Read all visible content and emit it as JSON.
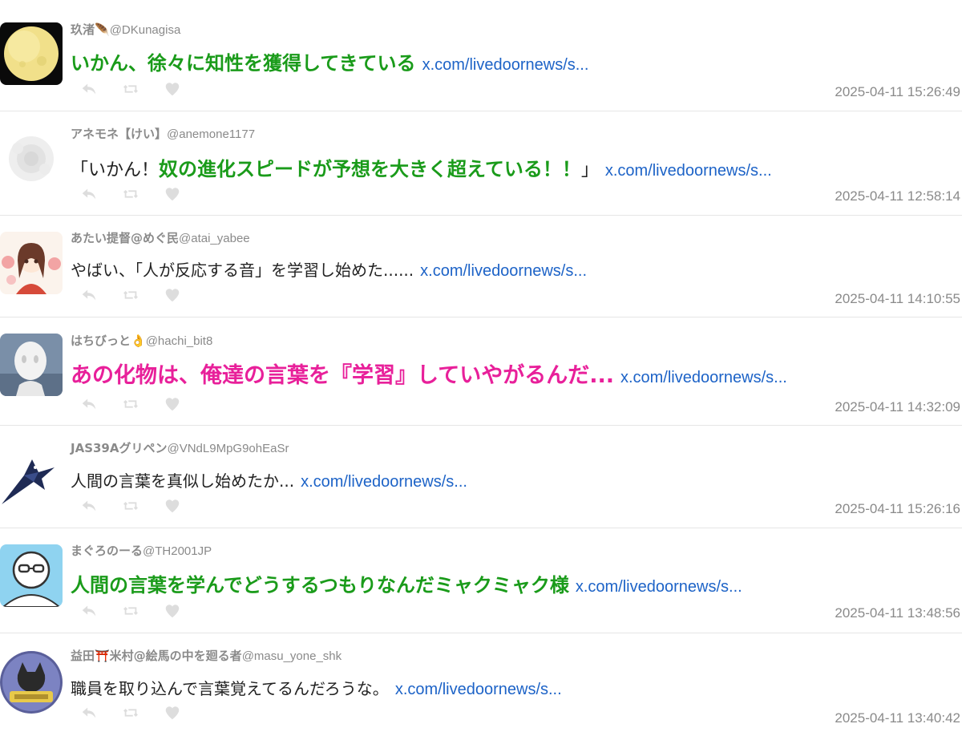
{
  "tweets": [
    {
      "username": "玖渚🪶",
      "handle": "@DKunagisa",
      "prefix": "",
      "highlight": "いかん、徐々に知性を獲得してきている",
      "suffix": "",
      "style": "green",
      "link": "x.com/livedoornews/s...",
      "timestamp": "2025-04-11 15:26:49",
      "avatar": "moon-avatar"
    },
    {
      "username": "アネモネ【けい】",
      "handle": "@anemone1177",
      "prefix": "「いかん！",
      "highlight": "奴の進化スピードが予想を大きく超えている！！",
      "suffix": "」",
      "style": "mixed",
      "link": "x.com/livedoornews/s...",
      "timestamp": "2025-04-11 12:58:14",
      "avatar": "faded-flower-avatar"
    },
    {
      "username": "あたい提督@めぐ民",
      "handle": "@atai_yabee",
      "prefix": "",
      "highlight": "やばい、「人が反応する音」を学習し始めた......",
      "suffix": "",
      "style": "normal",
      "link": "x.com/livedoornews/s...",
      "timestamp": "2025-04-11 14:10:55",
      "avatar": "anime-girl-avatar"
    },
    {
      "username": "はちびっと👌",
      "handle": "@hachi_bit8",
      "prefix": "",
      "highlight": "あの化物は、俺達の言葉を『学習』していやがるんだ...",
      "suffix": "",
      "style": "pink",
      "link": "x.com/livedoornews/s...",
      "timestamp": "2025-04-11 14:32:09",
      "avatar": "white-robot-avatar"
    },
    {
      "username": "JAS39Aグリペン",
      "handle": "@VNdL9MpG9ohEaSr",
      "prefix": "",
      "highlight": "人間の言葉を真似し始めたか...",
      "suffix": "",
      "style": "normal",
      "link": "x.com/livedoornews/s...",
      "timestamp": "2025-04-11 15:26:16",
      "avatar": "jet-avatar"
    },
    {
      "username": "まぐろのーる",
      "handle": "@TH2001JP",
      "prefix": "",
      "highlight": "人間の言葉を学んでどうするつもりなんだミャクミャク様",
      "suffix": "",
      "style": "green",
      "link": "x.com/livedoornews/s...",
      "timestamp": "2025-04-11 13:48:56",
      "avatar": "glasses-face-avatar"
    },
    {
      "username": "益田⛩️米村@絵馬の中を廻る者",
      "handle": "@masu_yone_shk",
      "prefix": "",
      "highlight": "職員を取り込んで言葉覚えてるんだろうな。",
      "suffix": "",
      "style": "normal",
      "link": "x.com/livedoornews/s...",
      "timestamp": "2025-04-11 13:40:42",
      "avatar": "cat-ema-avatar"
    }
  ],
  "actions": [
    "reply-icon",
    "retweet-icon",
    "like-icon"
  ],
  "colors": {
    "green": "#1a9b1a",
    "pink": "#e8209a",
    "link": "#1d63c7",
    "meta": "#8a8a8a",
    "action": "#dddddd"
  }
}
